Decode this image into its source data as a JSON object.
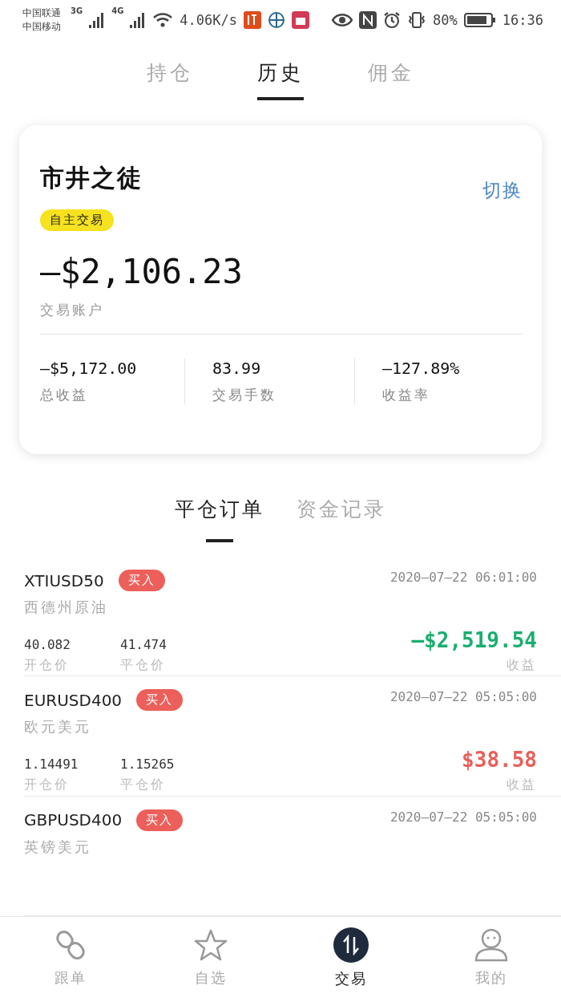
{
  "status_bar": {
    "carriers": [
      "中国联通",
      "中国移动"
    ],
    "networks": [
      "3G",
      "4G"
    ],
    "speed": "4.06K/s",
    "battery": "80%",
    "time": "16:36"
  },
  "tabs": [
    {
      "label": "持仓",
      "selected": false
    },
    {
      "label": "历史",
      "selected": true
    },
    {
      "label": "佣金",
      "selected": false
    }
  ],
  "account": {
    "name": "市井之徒",
    "tag": "自主交易",
    "switch": "切换",
    "balance": "—$2,106.23",
    "balance_label": "交易账户",
    "stats": [
      {
        "value": "—$5,172.00",
        "label": "总收益"
      },
      {
        "value": "83.99",
        "label": "交易手数"
      },
      {
        "value": "—127.89%",
        "label": "收益率"
      }
    ]
  },
  "sub_tabs": [
    {
      "label": "平仓订单",
      "selected": true
    },
    {
      "label": "资金记录",
      "selected": false
    }
  ],
  "orders": [
    {
      "symbol": "XTIUSD50",
      "side": "买入",
      "time": "2020—07—22 06:01:00",
      "name": "西德州原油",
      "open": "40.082",
      "open_label": "开仓价",
      "close": "41.474",
      "close_label": "平仓价",
      "profit": "—$2,519.54",
      "profit_label": "收益",
      "color": "#1aae6f"
    },
    {
      "symbol": "EURUSD400",
      "side": "买入",
      "time": "2020—07—22 05:05:00",
      "name": "欧元美元",
      "open": "1.14491",
      "open_label": "开仓价",
      "close": "1.15265",
      "close_label": "平仓价",
      "profit": "$38.58",
      "profit_label": "收益",
      "color": "#e8605a"
    },
    {
      "symbol": "GBPUSD400",
      "side": "买入",
      "time": "2020—07—22 05:05:00",
      "name": "英镑美元"
    }
  ],
  "nav": [
    {
      "label": "跟单",
      "kind": "link",
      "selected": false
    },
    {
      "label": "自选",
      "kind": "star",
      "selected": false
    },
    {
      "label": "交易",
      "kind": "trade",
      "selected": true
    },
    {
      "label": "我的",
      "kind": "user",
      "selected": false
    }
  ]
}
